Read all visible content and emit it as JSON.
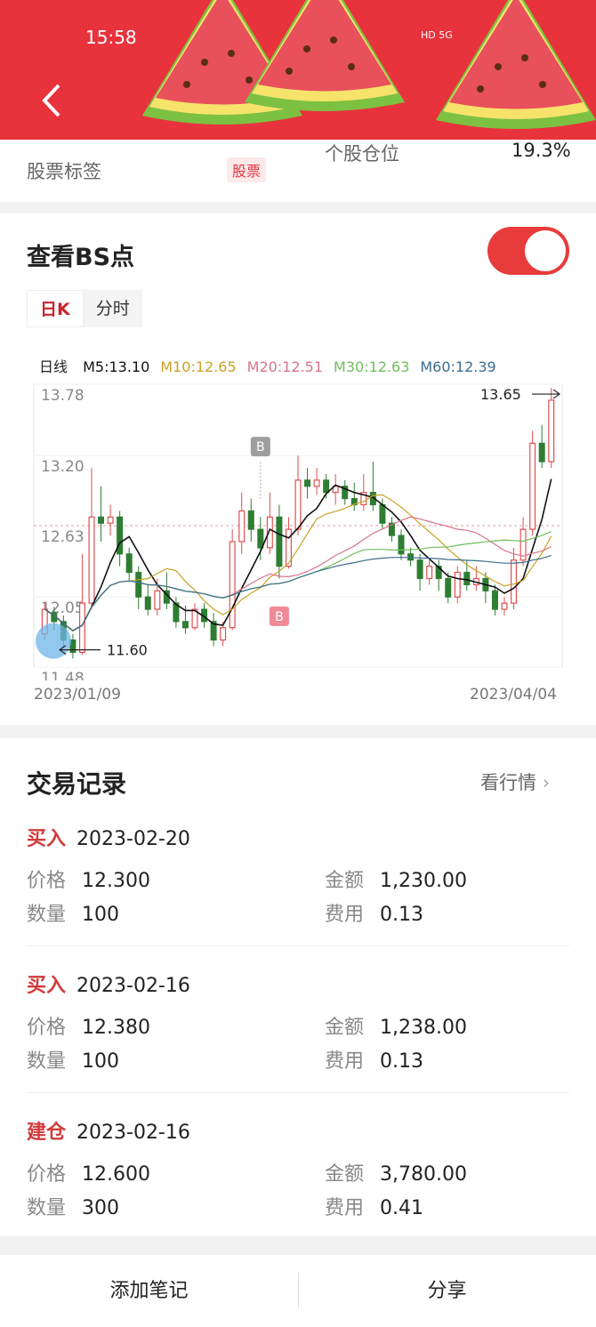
{
  "status_bar": {
    "time": "15:58",
    "icons": "HD 5G"
  },
  "top_card": {
    "tag_label": "股票标签",
    "tag_value": "股票",
    "position_label": "个股仓位",
    "position_value": "19.3%"
  },
  "bs_section": {
    "title": "查看BS点",
    "toggle_on": true,
    "tabs": [
      "日K",
      "分时"
    ],
    "active_tab": "日K"
  },
  "chart_data": {
    "type": "candlestick",
    "period_label": "日线",
    "ma": [
      {
        "name": "M5",
        "value": "13.10",
        "color": "#111111"
      },
      {
        "name": "M10",
        "value": "12.65",
        "color": "#c9a227"
      },
      {
        "name": "M20",
        "value": "12.51",
        "color": "#d9748a"
      },
      {
        "name": "M30",
        "value": "12.63",
        "color": "#6fbf5a"
      },
      {
        "name": "M60",
        "value": "12.39",
        "color": "#3c6e8f"
      }
    ],
    "y_ticks": [
      "13.78",
      "13.20",
      "12.63",
      "12.05",
      "11.48"
    ],
    "ylim": [
      11.48,
      13.78
    ],
    "high_marker": "13.65",
    "low_marker": "11.60",
    "x_start": "2023/01/09",
    "x_end": "2023/04/04",
    "bs_markers": [
      "B",
      "B"
    ],
    "candles": [
      [
        11.75,
        11.95,
        11.7,
        12.0
      ],
      [
        11.92,
        11.85,
        11.78,
        11.97
      ],
      [
        11.85,
        11.7,
        11.65,
        11.9
      ],
      [
        11.7,
        11.6,
        11.55,
        11.75
      ],
      [
        11.6,
        12.0,
        11.58,
        12.4
      ],
      [
        12.0,
        12.7,
        11.95,
        13.1
      ],
      [
        12.7,
        12.65,
        12.5,
        12.95
      ],
      [
        12.65,
        12.7,
        12.55,
        12.8
      ],
      [
        12.7,
        12.4,
        12.3,
        12.75
      ],
      [
        12.4,
        12.25,
        12.18,
        12.45
      ],
      [
        12.25,
        12.05,
        11.95,
        12.3
      ],
      [
        12.05,
        11.95,
        11.9,
        12.15
      ],
      [
        11.95,
        12.1,
        11.9,
        12.2
      ],
      [
        12.1,
        12.0,
        11.95,
        12.25
      ],
      [
        12.0,
        11.85,
        11.8,
        12.05
      ],
      [
        11.85,
        11.8,
        11.75,
        11.98
      ],
      [
        11.8,
        11.95,
        11.78,
        12.0
      ],
      [
        11.95,
        11.85,
        11.8,
        12.0
      ],
      [
        11.85,
        11.7,
        11.65,
        11.92
      ],
      [
        11.7,
        11.8,
        11.65,
        11.85
      ],
      [
        11.8,
        12.5,
        11.78,
        12.6
      ],
      [
        12.5,
        12.75,
        12.4,
        12.9
      ],
      [
        12.75,
        12.6,
        12.5,
        12.85
      ],
      [
        12.6,
        12.45,
        12.35,
        12.7
      ],
      [
        12.45,
        12.7,
        12.4,
        12.9
      ],
      [
        12.7,
        12.3,
        12.2,
        12.8
      ],
      [
        12.3,
        12.6,
        12.28,
        12.7
      ],
      [
        12.6,
        13.0,
        12.55,
        13.2
      ],
      [
        13.0,
        12.95,
        12.85,
        13.1
      ],
      [
        12.95,
        13.0,
        12.88,
        13.1
      ],
      [
        13.0,
        12.9,
        12.85,
        13.05
      ],
      [
        12.9,
        12.95,
        12.8,
        13.05
      ],
      [
        12.95,
        12.85,
        12.8,
        13.0
      ],
      [
        12.85,
        12.8,
        12.75,
        12.98
      ],
      [
        12.8,
        12.9,
        12.75,
        13.05
      ],
      [
        12.9,
        12.8,
        12.75,
        13.15
      ],
      [
        12.8,
        12.65,
        12.6,
        12.85
      ],
      [
        12.65,
        12.55,
        12.5,
        12.7
      ],
      [
        12.55,
        12.4,
        12.35,
        12.6
      ],
      [
        12.4,
        12.35,
        12.3,
        12.45
      ],
      [
        12.35,
        12.2,
        12.1,
        12.4
      ],
      [
        12.2,
        12.3,
        12.15,
        12.35
      ],
      [
        12.3,
        12.2,
        12.1,
        12.35
      ],
      [
        12.2,
        12.05,
        12.0,
        12.25
      ],
      [
        12.05,
        12.25,
        12.0,
        12.3
      ],
      [
        12.25,
        12.15,
        12.1,
        12.35
      ],
      [
        12.15,
        12.2,
        12.1,
        12.3
      ],
      [
        12.2,
        12.1,
        12.0,
        12.25
      ],
      [
        12.1,
        11.95,
        11.9,
        12.15
      ],
      [
        11.95,
        12.0,
        11.9,
        12.05
      ],
      [
        12.0,
        12.35,
        11.95,
        12.45
      ],
      [
        12.35,
        12.6,
        12.3,
        12.7
      ],
      [
        12.6,
        13.3,
        12.55,
        13.4
      ],
      [
        13.3,
        13.15,
        13.1,
        13.45
      ],
      [
        13.15,
        13.65,
        13.1,
        13.75
      ]
    ]
  },
  "trade_section": {
    "title": "交易记录",
    "more_label": "看行情",
    "records": [
      {
        "type": "买入",
        "date": "2023-02-20",
        "price_label": "价格",
        "price": "12.300",
        "amount_label": "金额",
        "amount": "1,230.00",
        "qty_label": "数量",
        "qty": "100",
        "fee_label": "费用",
        "fee": "0.13"
      },
      {
        "type": "买入",
        "date": "2023-02-16",
        "price_label": "价格",
        "price": "12.380",
        "amount_label": "金额",
        "amount": "1,238.00",
        "qty_label": "数量",
        "qty": "100",
        "fee_label": "费用",
        "fee": "0.13"
      },
      {
        "type": "建仓",
        "date": "2023-02-16",
        "price_label": "价格",
        "price": "12.600",
        "amount_label": "金额",
        "amount": "3,780.00",
        "qty_label": "数量",
        "qty": "300",
        "fee_label": "费用",
        "fee": "0.41"
      }
    ]
  },
  "footer": {
    "add_note": "添加笔记",
    "share": "分享"
  }
}
